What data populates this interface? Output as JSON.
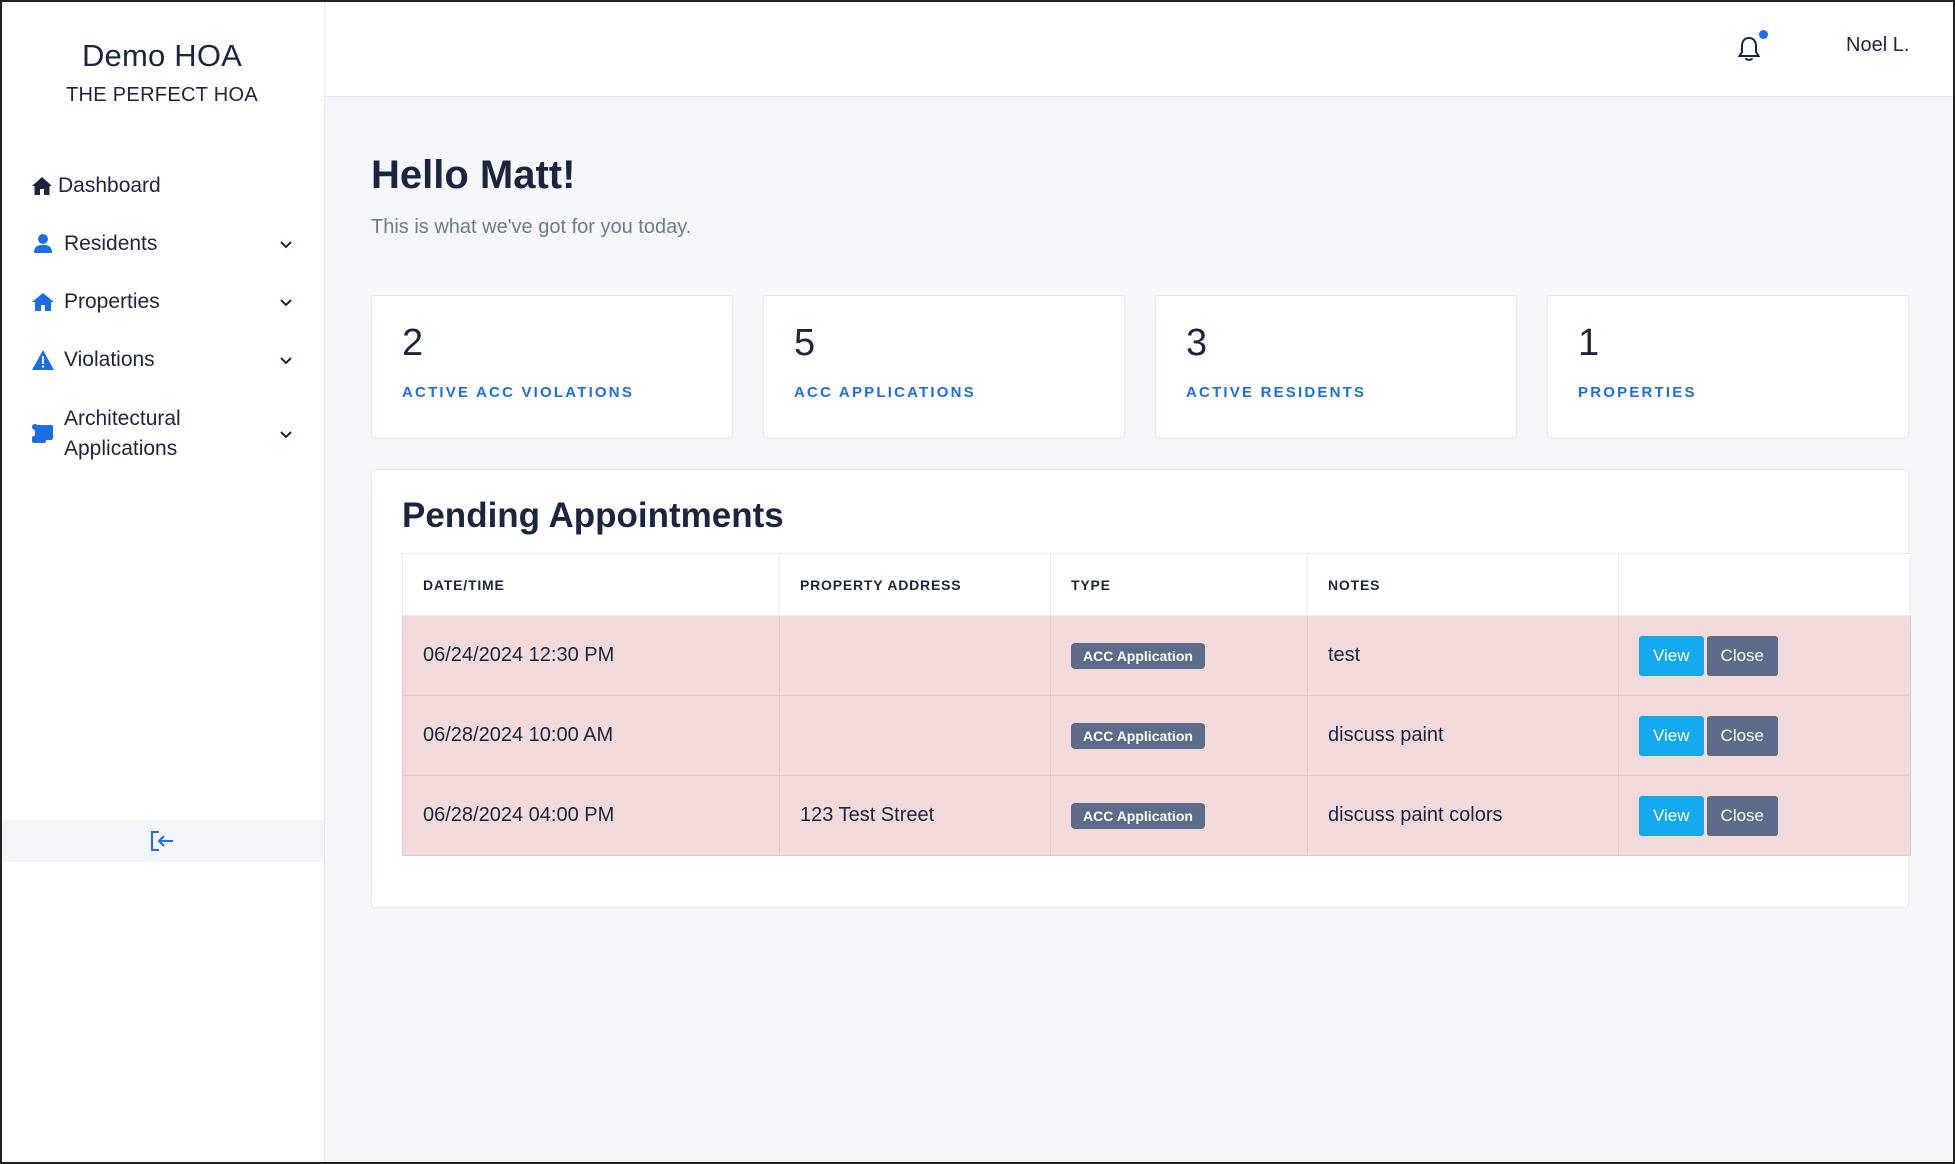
{
  "sidebar": {
    "brand_title": "Demo HOA",
    "brand_subtitle": "THE PERFECT HOA",
    "items": [
      {
        "label": "Dashboard",
        "icon": "home-icon"
      },
      {
        "label": "Residents",
        "icon": "user-icon"
      },
      {
        "label": "Properties",
        "icon": "house-icon"
      },
      {
        "label": "Violations",
        "icon": "warning-icon"
      },
      {
        "label": "Architectural Applications",
        "icon": "scroll-icon"
      }
    ]
  },
  "topbar": {
    "user_name": "Noel L."
  },
  "main": {
    "greeting": "Hello Matt!",
    "subtitle": "This is what we've got for you today.",
    "stats": [
      {
        "value": "2",
        "label": "ACTIVE ACC VIOLATIONS"
      },
      {
        "value": "5",
        "label": "ACC APPLICATIONS"
      },
      {
        "value": "3",
        "label": "ACTIVE RESIDENTS"
      },
      {
        "value": "1",
        "label": "PROPERTIES"
      }
    ],
    "appointments": {
      "title": "Pending Appointments",
      "columns": [
        "DATE/TIME",
        "PROPERTY ADDRESS",
        "TYPE",
        "NOTES",
        ""
      ],
      "rows": [
        {
          "datetime": "06/24/2024 12:30 PM",
          "address": "",
          "type": "ACC Application",
          "notes": "test"
        },
        {
          "datetime": "06/28/2024 10:00 AM",
          "address": "",
          "type": "ACC Application",
          "notes": "discuss paint"
        },
        {
          "datetime": "06/28/2024 04:00 PM",
          "address": "123 Test Street",
          "type": "ACC Application",
          "notes": "discuss paint colors"
        }
      ],
      "view_label": "View",
      "close_label": "Close"
    }
  },
  "colors": {
    "accent": "#1c6ee8",
    "row_highlight": "#f2d9da",
    "badge": "#5c6b89",
    "view_button": "#14a9ef"
  }
}
